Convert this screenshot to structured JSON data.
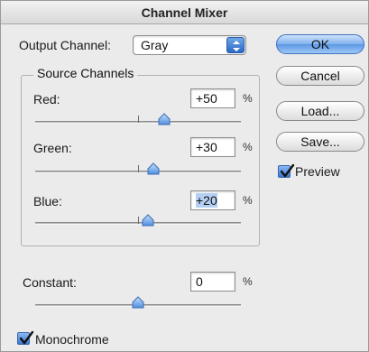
{
  "window": {
    "title": "Channel Mixer"
  },
  "output_channel": {
    "label": "Output Channel:",
    "value": "Gray"
  },
  "source_channels": {
    "legend": "Source Channels",
    "red": {
      "label": "Red:",
      "value": "+50",
      "unit": "%",
      "percent": 50
    },
    "green": {
      "label": "Green:",
      "value": "+30",
      "unit": "%",
      "percent": 30
    },
    "blue": {
      "label": "Blue:",
      "value": "+20",
      "unit": "%",
      "percent": 20
    }
  },
  "constant": {
    "label": "Constant:",
    "value": "0",
    "unit": "%",
    "percent": 0
  },
  "monochrome": {
    "label": "Monochrome",
    "checked": true
  },
  "buttons": {
    "ok": "OK",
    "cancel": "Cancel",
    "load": "Load...",
    "save": "Save..."
  },
  "preview": {
    "label": "Preview",
    "checked": true
  },
  "colors": {
    "accent": "#5b97e4",
    "selection": "#b4d0f3"
  }
}
